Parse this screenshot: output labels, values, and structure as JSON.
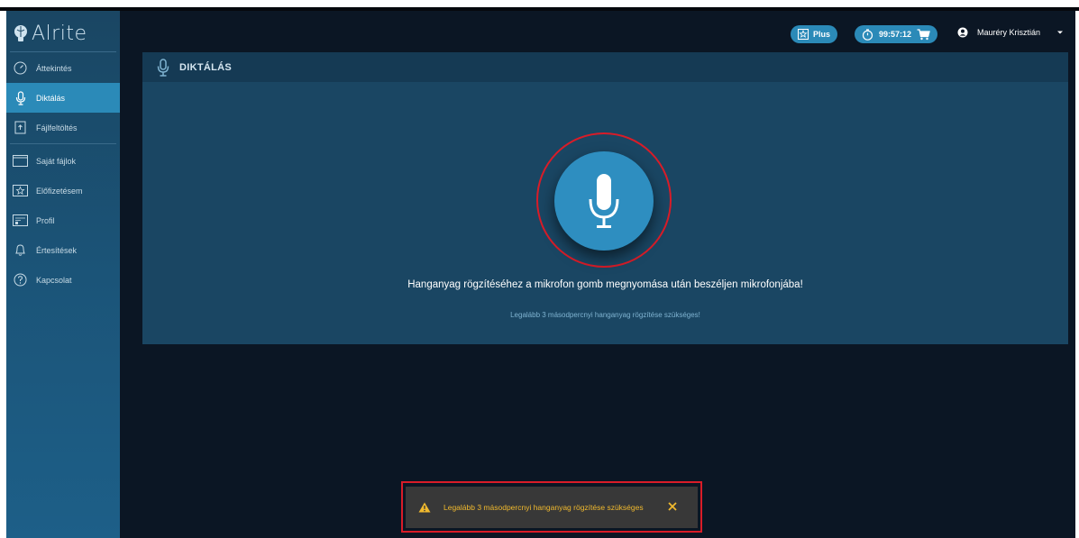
{
  "logo": {
    "text": "Alrite"
  },
  "sidebar": {
    "items": [
      {
        "label": "Áttekintés",
        "icon": "dashboard-icon"
      },
      {
        "label": "Diktálás",
        "icon": "microphone-icon",
        "active": true
      },
      {
        "label": "Fájlfeltöltés",
        "icon": "file-upload-icon"
      },
      {
        "label": "Saját fájlok",
        "icon": "folder-icon"
      },
      {
        "label": "Előfizetésem",
        "icon": "star-icon"
      },
      {
        "label": "Profil",
        "icon": "profile-card-icon"
      },
      {
        "label": "Értesítések",
        "icon": "bell-icon"
      },
      {
        "label": "Kapcsolat",
        "icon": "help-icon"
      }
    ]
  },
  "topbar": {
    "plus_label": "Plus",
    "timer": "99:57:12",
    "user_name": "Mauréry Krisztián"
  },
  "panel": {
    "title": "DIKTÁLÁS",
    "instruction": "Hanganyag rögzítéséhez a mikrofon gomb megnyomása után beszéljen mikrofonjába!",
    "note": "Legalább 3 másodpercnyi hanganyag rögzítése szükséges!"
  },
  "toast": {
    "message": "Legalább 3 másodpercnyi hanganyag rögzítése szükséges"
  },
  "colors": {
    "accent": "#2b8ab8",
    "sidebar": "#1a4663",
    "background": "#0b1624",
    "highlight": "#d91c28",
    "warning": "#f0b92e"
  }
}
